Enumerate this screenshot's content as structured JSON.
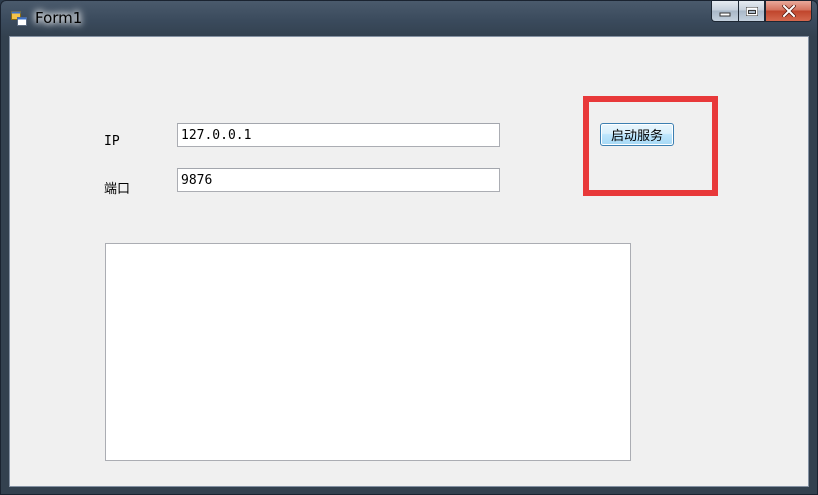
{
  "window": {
    "title": "Form1",
    "icon": "winforms-app-icon"
  },
  "caption_buttons": {
    "minimize_icon": "minimize-icon",
    "maximize_icon": "maximize-icon",
    "close_icon": "close-icon"
  },
  "form": {
    "ip_label": "IP",
    "ip_value": "127.0.0.1",
    "port_label": "端口",
    "port_value": "9876",
    "start_button_label": "启动服务",
    "log_text": ""
  },
  "annotation": {
    "highlight_color": "#e8393a"
  },
  "colors": {
    "client_bg": "#f0f0f0",
    "button_border": "#3c7fb1"
  }
}
